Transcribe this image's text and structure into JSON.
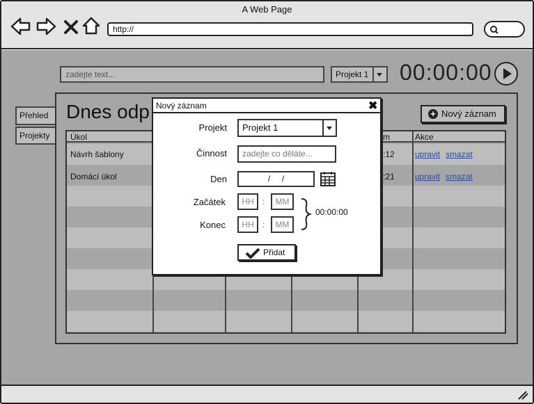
{
  "window": {
    "title": "A Web Page",
    "url": "http://"
  },
  "toolbar": {
    "search_placeholder": "zadejte text...",
    "project_selected": "Projekt 1",
    "timer": "00:00:00"
  },
  "tabs": [
    {
      "label": "Přehled"
    },
    {
      "label": "Projekty"
    }
  ],
  "page": {
    "heading": "Dnes odp",
    "add_record_label": "Nový záznam"
  },
  "table": {
    "headers": [
      "Úkol",
      "m",
      "Akce"
    ],
    "rows": [
      {
        "task": "Návrh šablony",
        "time": ":12",
        "edit": "upravit",
        "delete": "smazat"
      },
      {
        "task": "Domácí úkol",
        "time": ":21",
        "edit": "upravit",
        "delete": "smazat"
      }
    ]
  },
  "modal": {
    "title": "Nový záznam",
    "close": "✖",
    "project_label": "Projekt",
    "project_value": "Projekt 1",
    "activity_label": "Činnost",
    "activity_placeholder": "zadejte co děláte...",
    "day_label": "Den",
    "day_value": "/     /",
    "start_label": "Začátek",
    "end_label": "Konec",
    "hh": "HH",
    "mm": "MM",
    "colon": ":",
    "duration": "00:00:00",
    "submit_label": "Přidat"
  },
  "colors": {
    "viewport_bg": "#a6a6a6",
    "link": "#2a4aa0",
    "chrome_bg": "#e4e4e4"
  }
}
